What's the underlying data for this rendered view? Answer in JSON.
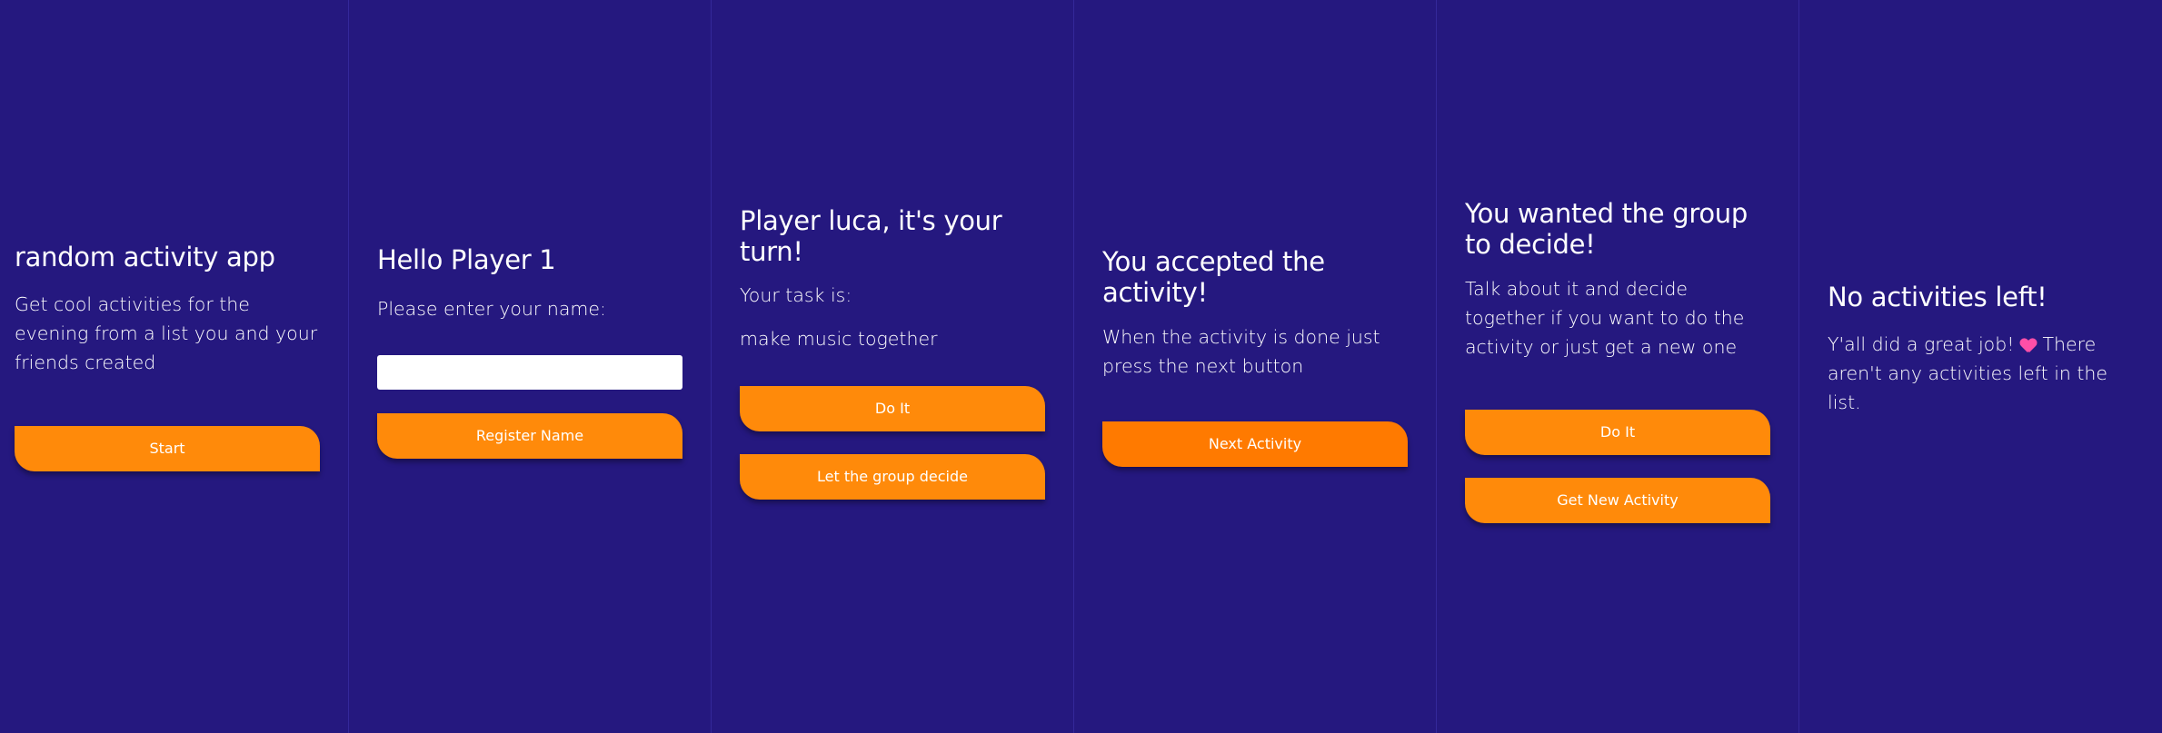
{
  "accent_color": "#ff8a0a",
  "background_color": "#25187f",
  "screens": [
    {
      "title": "random activity app",
      "body": "Get cool activities for the evening from a list you and your friends created",
      "button": "Start"
    },
    {
      "title": "Hello Player 1",
      "prompt": "Please enter your name:",
      "input_value": "",
      "button": "Register Name"
    },
    {
      "title": "Player luca, it's your turn!",
      "task_label": "Your task is:",
      "task": "make music together",
      "button_primary": "Do It",
      "button_secondary": "Let the group decide"
    },
    {
      "title": "You accepted the activity!",
      "body": "When the activity is done just press the next button",
      "button": "Next Activity"
    },
    {
      "title": "You wanted the group to decide!",
      "body": "Talk about it and decide together if you want to do the activity or just get a new one",
      "button_primary": "Do It",
      "button_secondary": "Get New Activity"
    },
    {
      "title": "No activities left!",
      "body_before": "Y'all did a great job!",
      "emoji": "heart-emoji",
      "body_after": " There aren't any activities left in the list."
    }
  ]
}
